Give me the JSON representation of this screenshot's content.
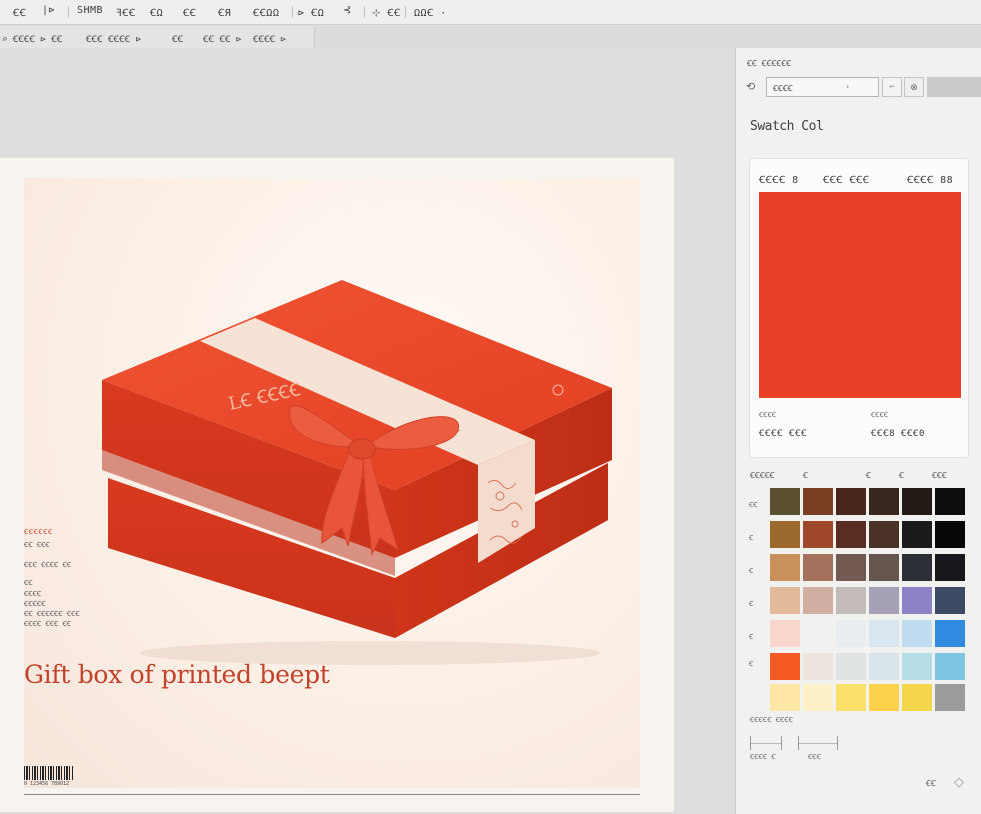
{
  "toolbar": {
    "items": [
      "ꞒꞒ",
      "|⊳",
      "SHMB",
      "ꟻꞒꞒ",
      "ꞒΩ",
      "ꞒꞒ",
      "ꞒЯ",
      "ꞒꞒΩΩ",
      "⊳ ꞒΩ",
      "⊰",
      "⊹ ꞒꞒ",
      "ΩΩꞒ ·"
    ]
  },
  "options_bar": {
    "items": [
      "⌕ ꞒꞒꞒꞒ ⊳ ꞒꞒ",
      "ꞒꞒꞒ ꞒꞒꞒꞒ ⊳",
      "ꞒꞒ",
      "ꞒꞒ ꞒꞒ ⊳",
      "ꞒꞒꞒꞒ ⊳"
    ]
  },
  "artboard": {
    "headline": "Gift box of printed beept",
    "brand_tag": "ꞒꞒꞒꞒꞒꞒ",
    "spec_lines": [
      "ꞒꞒ ꞒꞒꞒ",
      "ꞒꞒꞒ ꞒꞒꞒꞒ ꞒꞒ",
      "ꞒꞒ",
      "ꞒꞒꞒꞒ",
      "ꞒꞒꞒꞒꞒ",
      "ꞒꞒ ꞒꞒꞒꞒꞒꞒ ꞒꞒꞒ",
      "ꞒꞒꞒꞒ ꞒꞒꞒ ꞒꞒ"
    ],
    "barcode_number": "0 123456 789012",
    "box_lid_text": "LꞒ ꞒꞒꞒꞒ",
    "box_color": "#e64126"
  },
  "panel": {
    "title": "ꞒꞒ ꞒꞒꞒꞒꞒꞒ",
    "select_value": "ꞒꞒꞒꞒ",
    "heading": "Swatch Col",
    "card": {
      "headers": [
        "ꞒꞒꞒꞒ 8",
        "ꞒꞒꞒ ꞒꞒꞒ",
        "ꞒꞒꞒꞒ 88"
      ],
      "swatch_color": "#e64126",
      "left_label": "ꞒꞒꞒꞒ",
      "left_value": "ꞒꞒꞒꞒ ꞒꞒꞒ",
      "right_label": "ꞒꞒꞒꞒ",
      "right_value": "ꞒꞒꞒ8 ꞒꞒꞒ0"
    },
    "grid": {
      "headers": [
        "ꞒꞒꞒꞒꞒ",
        "Ꞓ",
        "Ꞓ",
        "Ꞓ",
        "ꞒꞒꞒ"
      ],
      "row_labels": [
        "ꞒꞒ",
        "Ꞓ",
        "Ꞓ",
        "Ꞓ",
        "Ꞓ",
        "Ꞓ"
      ],
      "rows": [
        [
          "#5a5030",
          "#7b3f22",
          "#48281c",
          "#3a2720",
          "#241a16",
          "#0f0d0c"
        ],
        [
          "#9c6a2c",
          "#a1472a",
          "#5a2d22",
          "#4b3227",
          "#1c1a1a",
          "#070707"
        ],
        [
          "#c8905a",
          "#a5705c",
          "#725951",
          "#66554f",
          "#2c2f35",
          "#17181c"
        ],
        [
          "#e2b99a",
          "#d2ada1",
          "#c3bbb7",
          "#a7a1b8",
          "#8c83c7",
          "#3d4a66"
        ],
        [
          "#f8d6cc",
          "#f3f1ef",
          "#e7edf1",
          "#d9e6f0",
          "#c0dcf1",
          "#2f8ae0"
        ],
        [
          "#f55a24",
          "#ede6df",
          "#dfe3e4",
          "#d8e4ea",
          "#b5dde6",
          "#7dc7e4"
        ],
        [
          "#fde6a6",
          "#fdf0c6",
          "#fbe16b",
          "#fbd24a",
          "#f4d64a",
          "#9b9b9b"
        ]
      ]
    },
    "sub_title": "ꞒꞒꞒꞒꞒ ꞒꞒꞒꞒ",
    "ruler_labels": [
      "ꞒꞒꞒꞒ Ꞓ",
      "ꞒꞒꞒ"
    ],
    "page_number": "ꞒꞒ"
  }
}
